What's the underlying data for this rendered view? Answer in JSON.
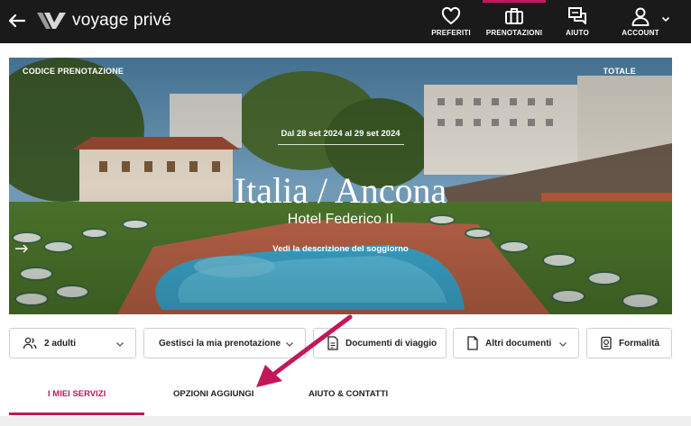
{
  "header": {
    "logo_text": "voyage privé",
    "nav": [
      {
        "label": "PREFERITI",
        "icon": "heart-icon"
      },
      {
        "label": "PRENOTAZIONI",
        "icon": "suitcase-icon"
      },
      {
        "label": "AIUTO",
        "icon": "chat-icon"
      },
      {
        "label": "ACCOUNT",
        "icon": "user-icon"
      }
    ],
    "accent_color": "#c2185b"
  },
  "hero": {
    "booking_code_label": "CODICE PRENOTAZIONE",
    "total_label": "TOTALE",
    "dates": "Dal 28 set 2024 al 29 set 2024",
    "title": "Italia / Ancona",
    "subtitle": "Hotel Federico II",
    "link_text": "Vedi la descrizione del soggiorno"
  },
  "actions": {
    "guests": "2 adulti",
    "manage": "Gestisci la mia prenotazione",
    "travel_docs": "Documenti di viaggio",
    "other_docs": "Altri documenti",
    "formalities": "Formalità"
  },
  "tabs": [
    {
      "label": "I MIEI SERVIZI",
      "active": true
    },
    {
      "label": "OPZIONI AGGIUNGI",
      "active": false
    },
    {
      "label": "AIUTO & CONTATTI",
      "active": false
    }
  ]
}
